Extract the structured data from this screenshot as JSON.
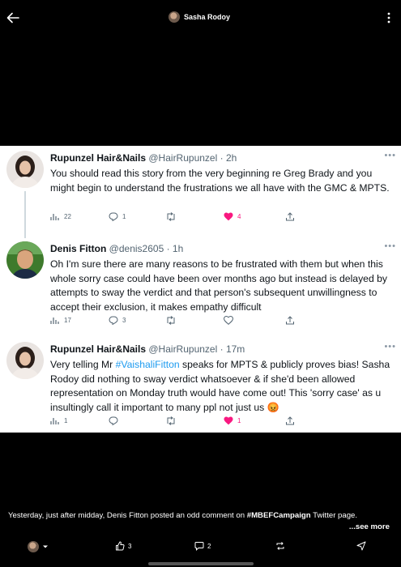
{
  "header": {
    "author_name": "Sasha Rodoy",
    "back_icon": "back-arrow-icon",
    "more_icon": "more-vertical-icon"
  },
  "tweets": [
    {
      "display_name": "Rupunzel Hair&Nails",
      "handle": "@HairRupunzel",
      "time": "2h",
      "text": "You should read this story from the very beginning re Greg Brady and you might  begin to understand the frustrations we all have with the GMC & MPTS.",
      "views": "22",
      "replies": "1",
      "retweets": "",
      "likes": "4",
      "liked": true
    },
    {
      "display_name": "Denis Fitton",
      "handle": "@denis2605",
      "time": "1h",
      "text": "Oh I'm sure there are many reasons to be frustrated with them but when this whole sorry case could have been over months ago but instead is delayed by attempts to sway the verdict and that person's subsequent unwillingness to accept their exclusion, it makes empathy difficult",
      "views": "17",
      "replies": "3",
      "retweets": "",
      "likes": "",
      "liked": false
    },
    {
      "display_name": "Rupunzel Hair&Nails",
      "handle": "@HairRupunzel",
      "time": "17m",
      "text_before_tag": "Very telling Mr ",
      "hashtag": "#VaishaliFitton",
      "text_after_tag": " speaks for MPTS & publicly proves bias! Sasha Rodoy did nothing to sway verdict whatsoever & if she'd been allowed representation on Monday truth would have come out! This 'sorry case' as u insultingly call it important to many ppl not just us 😡",
      "views": "1",
      "replies": "",
      "retweets": "",
      "likes": "1",
      "liked": true
    }
  ],
  "caption": {
    "text_before": "Yesterday, just after midday, Denis Fitton posted an odd comment on ",
    "hashtag": "#MBEFCampaign",
    "text_after": " Twitter page.",
    "see_more": "...see more"
  },
  "bottom_bar": {
    "likes": "3",
    "comments": "2"
  },
  "colors": {
    "link": "#1d9bf0",
    "like": "#f91880",
    "muted": "#536471",
    "background": "#000000"
  }
}
